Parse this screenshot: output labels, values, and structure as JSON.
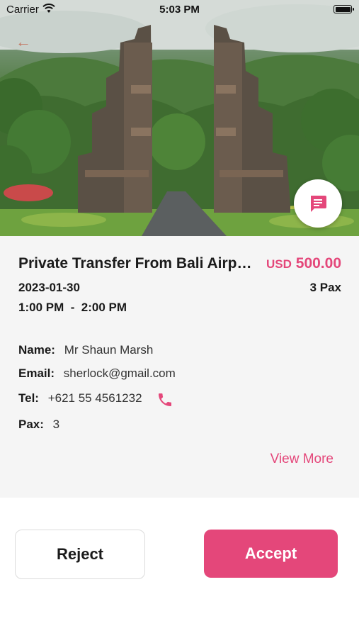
{
  "status_bar": {
    "carrier": "Carrier",
    "time": "5:03 PM"
  },
  "hero": {
    "image": "bali-temple-gate-photo",
    "back_icon": "back-arrow-icon",
    "chat_icon": "chat-message-icon"
  },
  "booking": {
    "title": "Private Transfer From Bali Airport",
    "currency": "USD",
    "amount": "500.00",
    "date": "2023-01-30",
    "pax_summary": "3 Pax",
    "time_range": "1:00 PM  -  2:00 PM"
  },
  "guest": {
    "name_label": "Name:",
    "name": "Mr Shaun Marsh",
    "email_label": "Email:",
    "email": "sherlock@gmail.com",
    "tel_label": "Tel:",
    "tel": "+621 55 4561232",
    "pax_label": "Pax:",
    "pax": "3"
  },
  "actions": {
    "view_more": "View More",
    "reject": "Reject",
    "accept": "Accept"
  },
  "colors": {
    "accent": "#e4477a",
    "panel_bg": "#f5f5f5"
  }
}
